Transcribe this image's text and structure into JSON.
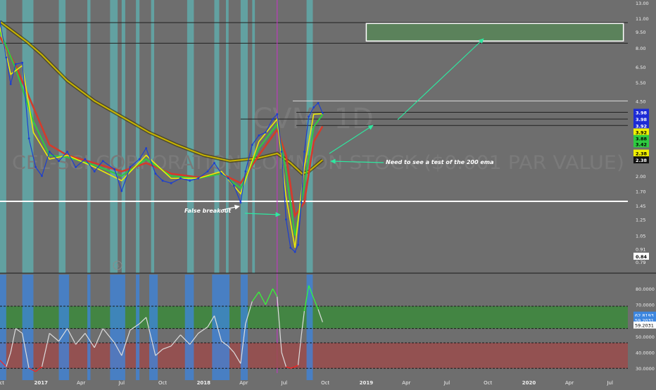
{
  "watermark": {
    "symbol": "CVM, 1D",
    "description": "CEL-SCI CORPORATION COMMON STOCK ($0.001 PAR VALUE)"
  },
  "annotations": {
    "false_breakout": "False breakout",
    "need_test": "Need to see a test of the 200 ema",
    "circle_marker": "5"
  },
  "colors": {
    "background": "#6e6e6e",
    "highlight_band": "#5fb3b3",
    "rsi_highlight_band": "#3c86e0",
    "ema_200": "#c8b400",
    "ema_fast": "#f0f000",
    "ema_mid": "#2ecc40",
    "ema_slow": "#d63a2a",
    "annotation_arrow": "#2ee8a0",
    "target_box": "#4f8f4f",
    "overbought_zone": "#3c8a3c",
    "oversold_zone": "#9a4c4c",
    "rsi_hot": "#33ff33",
    "rsi_cold": "#ff2020",
    "rsi_mid": "#dddddd"
  },
  "chart_data": [
    {
      "type": "line",
      "title": "",
      "scale": "log",
      "ylim": [
        0.79,
        13.0
      ],
      "xlim": [
        "2016-10-01",
        "2020-08-10"
      ],
      "price_axis_ticks": [
        "13.00",
        "11.00",
        "9.50",
        "8.00",
        "6.50",
        "5.50",
        "4.50",
        "3.50",
        "2.80",
        "2.00",
        "1.70",
        "1.45",
        "1.25",
        "1.05",
        "0.91",
        "0.79"
      ],
      "price_labels": [
        {
          "text": "3.98",
          "value": 3.98,
          "color": "#1c2bd6",
          "text_color": "#ffffff"
        },
        {
          "text": "3.98",
          "value": 3.7,
          "color": "#1c2bd6",
          "text_color": "#ffffff"
        },
        {
          "text": "3.92",
          "value": 3.45,
          "color": "#1c2bd6",
          "text_color": "#ffffff"
        },
        {
          "text": "3.92",
          "value": 3.22,
          "color": "#f0f000",
          "text_color": "#000000"
        },
        {
          "text": "3.88",
          "value": 3.0,
          "color": "#2ecc40",
          "text_color": "#000000"
        },
        {
          "text": "3.42",
          "value": 2.83,
          "color": "#2ecc40",
          "text_color": "#000000"
        },
        {
          "text": "2.38",
          "value": 2.56,
          "color": "#f0f000",
          "text_color": "#000000"
        },
        {
          "text": "2.38",
          "value": 2.38,
          "color": "#111111",
          "text_color": "#ffffff"
        },
        {
          "text": "0.84",
          "value": 0.84,
          "color": "#ffffff",
          "text_color": "#000000"
        }
      ],
      "horizontal_levels": [
        {
          "name": "support",
          "value": 1.52,
          "color": "#ffffff",
          "width": 2,
          "from": "2016-10-01"
        },
        {
          "name": "resistance-top",
          "value": 10.5,
          "color": "#222222",
          "width": 1,
          "from": "2016-10-01"
        },
        {
          "name": "resistance-mid",
          "value": 8.4,
          "color": "#222222",
          "width": 1,
          "from": "2016-10-01"
        },
        {
          "name": "recent-high",
          "value": 4.5,
          "color": "#dddddd",
          "width": 1,
          "from": "2018-07-20"
        },
        {
          "name": "level-398",
          "value": 3.98,
          "color": "#222222",
          "width": 1,
          "from": "2018-07-28"
        },
        {
          "name": "level-370",
          "value": 3.7,
          "color": "#222222",
          "width": 1,
          "from": "2018-03-25"
        },
        {
          "name": "level-345",
          "value": 3.45,
          "color": "#222222",
          "width": 1,
          "from": "2018-07-28"
        }
      ],
      "target_box": {
        "x0": "2019-01-01",
        "x1": "2020-07-31",
        "y_low": 8.6,
        "y_high": 10.4
      },
      "highlight_bands": [
        [
          "2016-10-01",
          "2016-10-15"
        ],
        [
          "2016-11-20",
          "2016-12-15"
        ],
        [
          "2017-02-10",
          "2017-02-25"
        ],
        [
          "2017-04-15",
          "2017-04-22"
        ],
        [
          "2017-06-05",
          "2017-06-22"
        ],
        [
          "2017-07-01",
          "2017-07-09"
        ],
        [
          "2017-08-02",
          "2017-08-10"
        ],
        [
          "2017-09-05",
          "2017-09-12"
        ],
        [
          "2017-11-25",
          "2017-12-10"
        ],
        [
          "2018-01-25",
          "2018-02-05"
        ],
        [
          "2018-02-20",
          "2018-02-26"
        ],
        [
          "2018-03-25",
          "2018-04-10"
        ],
        [
          "2018-04-20",
          "2018-04-26"
        ],
        [
          "2018-08-20",
          "2018-09-03"
        ]
      ],
      "event_line": {
        "x": "2018-06-15",
        "color": "#cc33cc"
      },
      "price_series": [
        [
          "2016-10-01",
          10.6
        ],
        [
          "2016-10-15",
          7.2
        ],
        [
          "2016-10-25",
          5.4
        ],
        [
          "2016-11-05",
          6.7
        ],
        [
          "2016-11-20",
          6.8
        ],
        [
          "2016-12-05",
          3.0
        ],
        [
          "2016-12-20",
          2.2
        ],
        [
          "2017-01-03",
          2.0
        ],
        [
          "2017-01-20",
          2.6
        ],
        [
          "2017-02-10",
          2.35
        ],
        [
          "2017-03-01",
          2.6
        ],
        [
          "2017-03-20",
          2.2
        ],
        [
          "2017-04-10",
          2.4
        ],
        [
          "2017-05-01",
          2.1
        ],
        [
          "2017-05-20",
          2.35
        ],
        [
          "2017-06-15",
          2.15
        ],
        [
          "2017-07-01",
          1.7
        ],
        [
          "2017-07-20",
          2.2
        ],
        [
          "2017-08-10",
          2.4
        ],
        [
          "2017-08-25",
          2.7
        ],
        [
          "2017-09-15",
          2.05
        ],
        [
          "2017-10-01",
          1.9
        ],
        [
          "2017-10-20",
          1.85
        ],
        [
          "2017-11-10",
          1.95
        ],
        [
          "2017-12-01",
          1.9
        ],
        [
          "2017-12-20",
          1.95
        ],
        [
          "2018-01-10",
          2.1
        ],
        [
          "2018-01-25",
          2.3
        ],
        [
          "2018-02-10",
          2.05
        ],
        [
          "2018-02-25",
          1.95
        ],
        [
          "2018-03-10",
          1.8
        ],
        [
          "2018-03-25",
          1.5
        ],
        [
          "2018-04-05",
          2.1
        ],
        [
          "2018-04-20",
          2.8
        ],
        [
          "2018-05-05",
          3.1
        ],
        [
          "2018-05-20",
          3.2
        ],
        [
          "2018-06-05",
          3.7
        ],
        [
          "2018-06-15",
          3.9
        ],
        [
          "2018-06-25",
          2.6
        ],
        [
          "2018-07-05",
          1.25
        ],
        [
          "2018-07-15",
          0.92
        ],
        [
          "2018-07-25",
          0.88
        ],
        [
          "2018-08-01",
          0.95
        ],
        [
          "2018-08-08",
          1.5
        ],
        [
          "2018-08-15",
          2.6
        ],
        [
          "2018-08-25",
          3.8
        ],
        [
          "2018-09-05",
          4.2
        ],
        [
          "2018-09-15",
          4.4
        ],
        [
          "2018-09-25",
          3.95
        ]
      ],
      "ema_200": [
        [
          "2016-10-01",
          10.6
        ],
        [
          "2016-12-01",
          8.5
        ],
        [
          "2017-01-03",
          7.4
        ],
        [
          "2017-03-01",
          5.6
        ],
        [
          "2017-05-01",
          4.5
        ],
        [
          "2017-07-01",
          3.8
        ],
        [
          "2017-09-01",
          3.2
        ],
        [
          "2017-11-01",
          2.8
        ],
        [
          "2018-01-01",
          2.5
        ],
        [
          "2018-03-01",
          2.35
        ],
        [
          "2018-05-01",
          2.42
        ],
        [
          "2018-06-15",
          2.55
        ],
        [
          "2018-07-15",
          2.3
        ],
        [
          "2018-08-10",
          2.05
        ],
        [
          "2018-08-25",
          2.1
        ],
        [
          "2018-09-25",
          2.38
        ]
      ],
      "ema_fast": [
        [
          "2016-10-01",
          10.0
        ],
        [
          "2016-10-25",
          6.0
        ],
        [
          "2016-11-20",
          6.6
        ],
        [
          "2016-12-15",
          3.2
        ],
        [
          "2017-01-20",
          2.4
        ],
        [
          "2017-03-01",
          2.5
        ],
        [
          "2017-05-01",
          2.2
        ],
        [
          "2017-07-01",
          1.9
        ],
        [
          "2017-08-25",
          2.5
        ],
        [
          "2017-10-20",
          1.95
        ],
        [
          "2017-12-20",
          1.95
        ],
        [
          "2018-02-10",
          2.1
        ],
        [
          "2018-03-25",
          1.65
        ],
        [
          "2018-05-05",
          2.9
        ],
        [
          "2018-06-15",
          3.7
        ],
        [
          "2018-07-05",
          1.6
        ],
        [
          "2018-07-25",
          0.92
        ],
        [
          "2018-08-15",
          2.2
        ],
        [
          "2018-09-05",
          3.9
        ],
        [
          "2018-09-25",
          3.92
        ]
      ],
      "ema_mid": [
        [
          "2016-10-01",
          9.5
        ],
        [
          "2016-11-05",
          6.4
        ],
        [
          "2016-12-15",
          3.6
        ],
        [
          "2017-01-20",
          2.5
        ],
        [
          "2017-03-01",
          2.45
        ],
        [
          "2017-05-01",
          2.25
        ],
        [
          "2017-07-01",
          2.0
        ],
        [
          "2017-08-25",
          2.4
        ],
        [
          "2017-10-20",
          2.0
        ],
        [
          "2017-12-20",
          1.95
        ],
        [
          "2018-02-10",
          2.05
        ],
        [
          "2018-03-25",
          1.75
        ],
        [
          "2018-05-05",
          2.7
        ],
        [
          "2018-06-15",
          3.5
        ],
        [
          "2018-07-05",
          2.1
        ],
        [
          "2018-07-25",
          1.05
        ],
        [
          "2018-08-15",
          1.8
        ],
        [
          "2018-09-05",
          3.4
        ],
        [
          "2018-09-25",
          3.88
        ]
      ],
      "ema_slow": [
        [
          "2016-10-01",
          9.0
        ],
        [
          "2016-11-05",
          6.6
        ],
        [
          "2016-12-15",
          4.2
        ],
        [
          "2017-01-20",
          2.8
        ],
        [
          "2017-03-01",
          2.5
        ],
        [
          "2017-05-01",
          2.3
        ],
        [
          "2017-07-01",
          2.1
        ],
        [
          "2017-08-25",
          2.3
        ],
        [
          "2017-10-20",
          2.05
        ],
        [
          "2017-12-20",
          1.97
        ],
        [
          "2018-02-10",
          2.05
        ],
        [
          "2018-03-25",
          1.85
        ],
        [
          "2018-05-05",
          2.5
        ],
        [
          "2018-06-15",
          3.3
        ],
        [
          "2018-07-05",
          2.5
        ],
        [
          "2018-07-25",
          1.3
        ],
        [
          "2018-08-15",
          1.5
        ],
        [
          "2018-09-05",
          2.9
        ],
        [
          "2018-09-25",
          3.42
        ]
      ]
    },
    {
      "type": "line",
      "title": "",
      "ylim": [
        27,
        88
      ],
      "y_ticks": [
        "80.0000",
        "70.0000",
        "60.0000",
        "50.0000",
        "40.0000",
        "30.0000"
      ],
      "overbought_zone": [
        55,
        69
      ],
      "oversold_zone": [
        30,
        46
      ],
      "dashed_levels": [
        69,
        55,
        46,
        30
      ],
      "value_labels": [
        {
          "text": "62.8193",
          "value": 63.4,
          "color": "#3c86e0",
          "text_color": "#ffffff"
        },
        {
          "text": "59.2031",
          "value": 60.3,
          "color": "#3c86e0",
          "text_color": "#ffffff"
        },
        {
          "text": "59.2031",
          "value": 57.2,
          "color": "#ffffff",
          "text_color": "#000000"
        }
      ],
      "highlight_bands": [
        [
          "2016-10-01",
          "2016-10-15"
        ],
        [
          "2016-11-20",
          "2016-12-15"
        ],
        [
          "2017-02-10",
          "2017-03-05"
        ],
        [
          "2017-04-15",
          "2017-04-22"
        ],
        [
          "2017-06-05",
          "2017-07-09"
        ],
        [
          "2017-08-02",
          "2017-08-10"
        ],
        [
          "2017-09-01",
          "2017-09-20"
        ],
        [
          "2017-11-20",
          "2017-12-10"
        ],
        [
          "2018-01-20",
          "2018-02-28"
        ],
        [
          "2018-03-25",
          "2018-04-10"
        ],
        [
          "2018-08-20",
          "2018-09-03"
        ]
      ],
      "series": [
        [
          "2016-10-01",
          35
        ],
        [
          "2016-10-15",
          31
        ],
        [
          "2016-10-25",
          40
        ],
        [
          "2016-11-05",
          55
        ],
        [
          "2016-11-20",
          52
        ],
        [
          "2016-12-05",
          30
        ],
        [
          "2016-12-20",
          28
        ],
        [
          "2017-01-03",
          31
        ],
        [
          "2017-01-20",
          52
        ],
        [
          "2017-02-10",
          47
        ],
        [
          "2017-03-01",
          55
        ],
        [
          "2017-03-20",
          45
        ],
        [
          "2017-04-10",
          52
        ],
        [
          "2017-05-01",
          43
        ],
        [
          "2017-05-20",
          55
        ],
        [
          "2017-06-15",
          46
        ],
        [
          "2017-07-01",
          38
        ],
        [
          "2017-07-20",
          54
        ],
        [
          "2017-08-10",
          58
        ],
        [
          "2017-08-25",
          62
        ],
        [
          "2017-09-15",
          38
        ],
        [
          "2017-10-01",
          42
        ],
        [
          "2017-10-20",
          44
        ],
        [
          "2017-11-10",
          51
        ],
        [
          "2017-12-01",
          45
        ],
        [
          "2017-12-20",
          52
        ],
        [
          "2018-01-10",
          56
        ],
        [
          "2018-01-25",
          63
        ],
        [
          "2018-02-10",
          47
        ],
        [
          "2018-02-25",
          44
        ],
        [
          "2018-03-10",
          40
        ],
        [
          "2018-03-25",
          33
        ],
        [
          "2018-04-05",
          58
        ],
        [
          "2018-04-20",
          72
        ],
        [
          "2018-05-05",
          78
        ],
        [
          "2018-05-20",
          70
        ],
        [
          "2018-06-05",
          80
        ],
        [
          "2018-06-15",
          75
        ],
        [
          "2018-06-25",
          40
        ],
        [
          "2018-07-05",
          31
        ],
        [
          "2018-07-15",
          30
        ],
        [
          "2018-07-25",
          31
        ],
        [
          "2018-08-01",
          32
        ],
        [
          "2018-08-08",
          50
        ],
        [
          "2018-08-15",
          66
        ],
        [
          "2018-08-25",
          82
        ],
        [
          "2018-09-05",
          74
        ],
        [
          "2018-09-15",
          67
        ],
        [
          "2018-09-25",
          59
        ]
      ]
    }
  ],
  "time_axis": [
    {
      "label": "Oct",
      "date": "2016-10-01",
      "bold": false
    },
    {
      "label": "2017",
      "date": "2017-01-01",
      "bold": true
    },
    {
      "label": "Apr",
      "date": "2017-04-01",
      "bold": false
    },
    {
      "label": "Jul",
      "date": "2017-07-01",
      "bold": false
    },
    {
      "label": "Oct",
      "date": "2017-10-01",
      "bold": false
    },
    {
      "label": "2018",
      "date": "2018-01-01",
      "bold": true
    },
    {
      "label": "Apr",
      "date": "2018-04-01",
      "bold": false
    },
    {
      "label": "Jul",
      "date": "2018-07-01",
      "bold": false
    },
    {
      "label": "Oct",
      "date": "2018-10-01",
      "bold": false
    },
    {
      "label": "2019",
      "date": "2019-01-01",
      "bold": true
    },
    {
      "label": "Apr",
      "date": "2019-04-01",
      "bold": false
    },
    {
      "label": "Jul",
      "date": "2019-07-01",
      "bold": false
    },
    {
      "label": "Oct",
      "date": "2019-10-01",
      "bold": false
    },
    {
      "label": "2020",
      "date": "2020-01-01",
      "bold": true
    },
    {
      "label": "Apr",
      "date": "2020-04-01",
      "bold": false
    },
    {
      "label": "Jul",
      "date": "2020-07-01",
      "bold": false
    }
  ]
}
